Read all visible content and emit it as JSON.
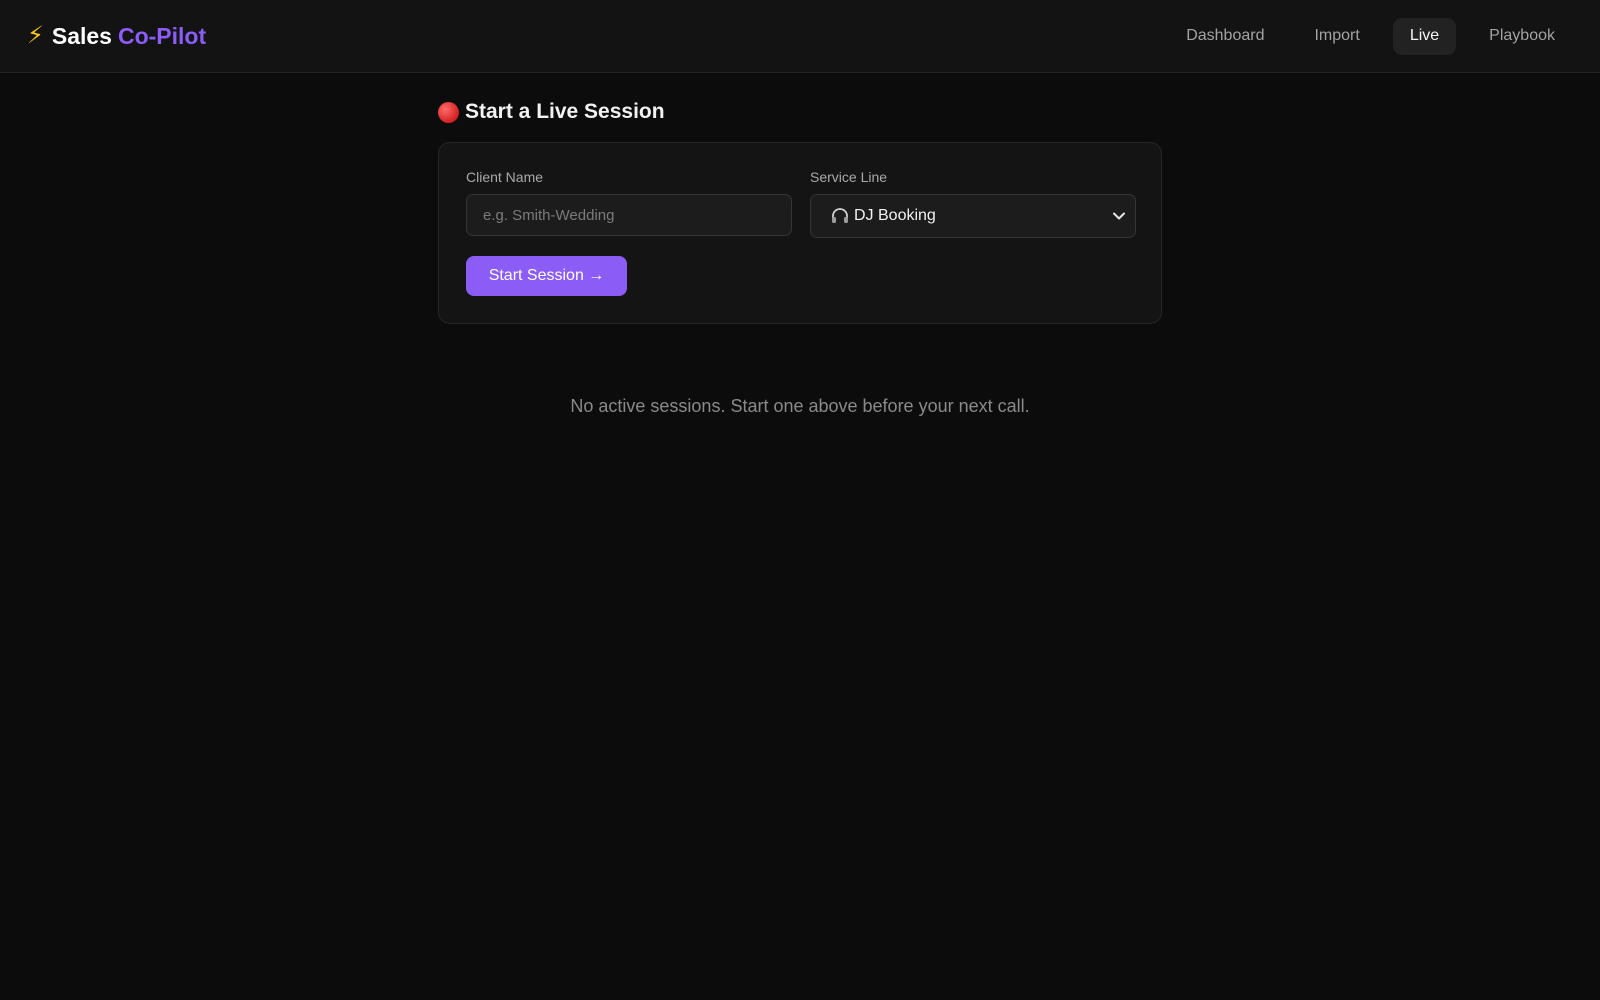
{
  "header": {
    "brand_primary": "Sales",
    "brand_accent": "Co-Pilot",
    "nav": [
      {
        "label": "Dashboard",
        "active": false
      },
      {
        "label": "Import",
        "active": false
      },
      {
        "label": "Live",
        "active": true
      },
      {
        "label": "Playbook",
        "active": false
      }
    ]
  },
  "session": {
    "title": "Start a Live Session",
    "client_label": "Client Name",
    "client_value": "",
    "client_placeholder": "e.g. Smith-Wedding",
    "service_label": "Service Line",
    "service_selected": "DJ Booking",
    "start_button": "Start Session →"
  },
  "empty_state": "No active sessions. Start one above before your next call.",
  "colors": {
    "accent": "#8b5cf6",
    "background": "#0c0c0c",
    "bolt": "#f5c518"
  },
  "icons": [
    "bolt-icon",
    "rec-dot-icon",
    "headphones-icon",
    "chevron-down-icon"
  ]
}
